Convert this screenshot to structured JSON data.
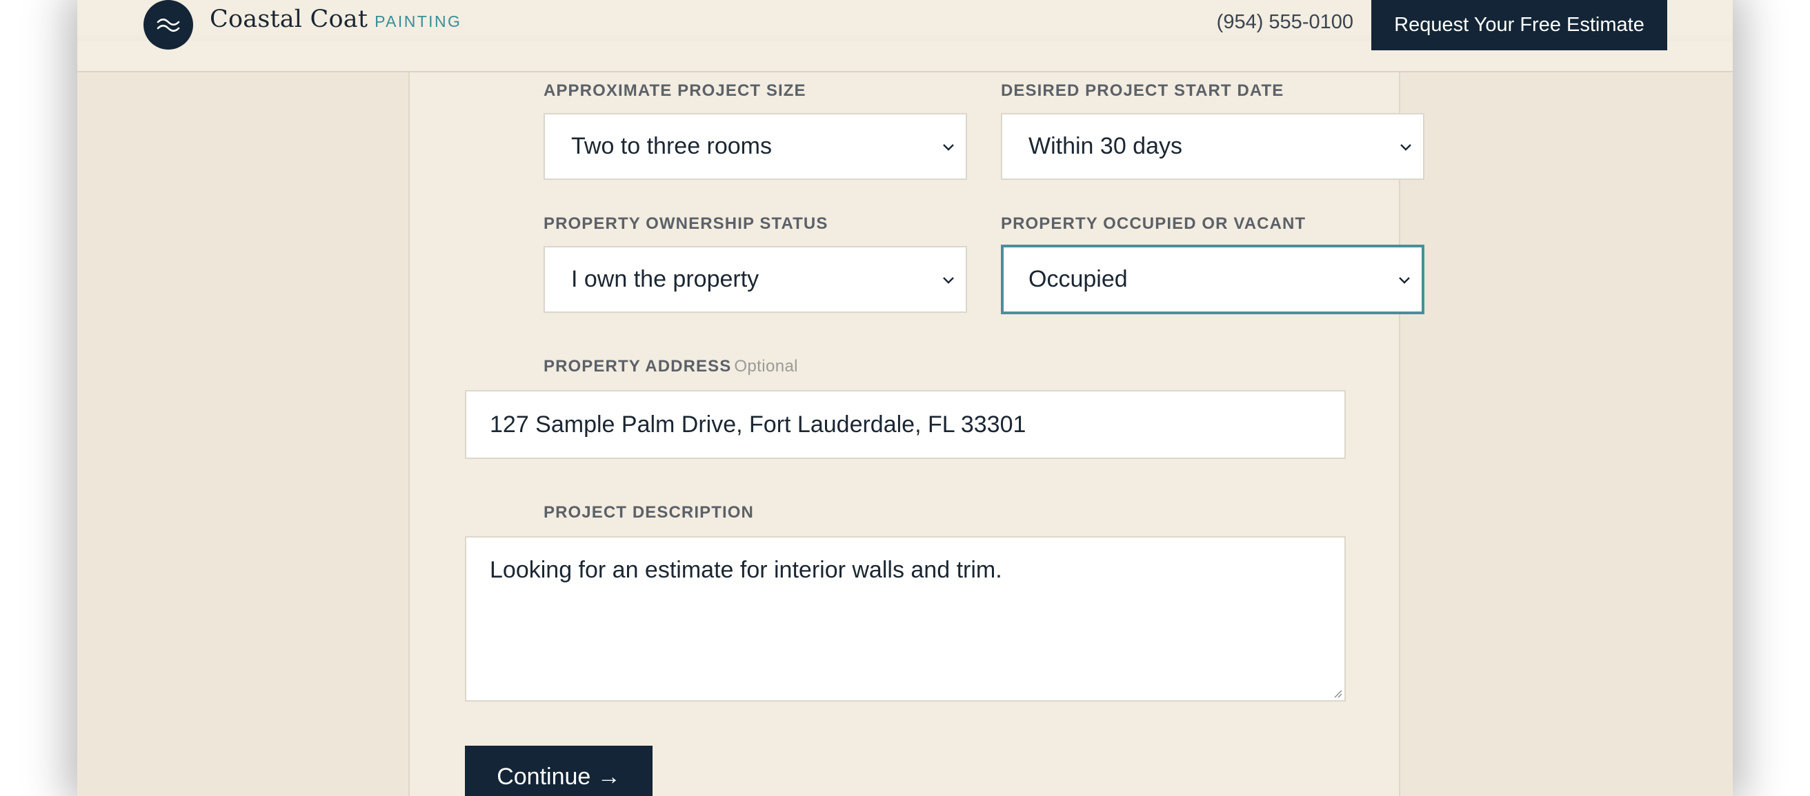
{
  "header": {
    "brand_name": "Coastal Coat",
    "brand_sub": "PAINTING",
    "logo_icon": "waves-icon",
    "phone": "(954) 555-0100",
    "cta_label": "Request Your Free Estimate"
  },
  "form": {
    "project_size": {
      "label": "APPROXIMATE PROJECT SIZE",
      "value": "Two to three rooms"
    },
    "start_date": {
      "label": "DESIRED PROJECT START DATE",
      "value": "Within 30 days"
    },
    "ownership": {
      "label": "PROPERTY OWNERSHIP STATUS",
      "value": "I own the property"
    },
    "occupancy": {
      "label": "PROPERTY OCCUPIED OR VACANT",
      "value": "Occupied"
    },
    "address": {
      "label": "PROPERTY ADDRESS",
      "optional": "Optional",
      "value": "127 Sample Palm Drive, Fort Lauderdale, FL 33301"
    },
    "description": {
      "label": "PROJECT DESCRIPTION",
      "value": "Looking for an estimate for interior walls and trim."
    },
    "continue_label": "Continue →"
  },
  "colors": {
    "navy": "#132536",
    "accent_teal": "#3a8e95",
    "focus_border": "#4a8f99",
    "page_background": "#efe6da",
    "panel_background": "#f3ece0"
  }
}
